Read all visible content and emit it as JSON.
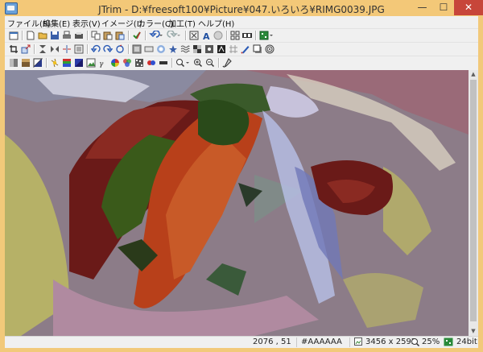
{
  "window": {
    "title": "JTrim - D:¥freesoft100¥Picture¥047.いろいろ¥RIMG0039.JPG"
  },
  "window_controls": {
    "minimize": "—",
    "maximize": "☐",
    "close": "✕"
  },
  "menu": [
    "ファイル(F)",
    "編集(E)",
    "表示(V)",
    "イメージ(I)",
    "カラー(C)",
    "加工(T)",
    "ヘルプ(H)"
  ],
  "toolbars": {
    "row1": [
      "new-window",
      "new",
      "open",
      "save",
      "print",
      "copy",
      "paste",
      "paste-new",
      "apply",
      "undo",
      "redo",
      "fit-window",
      "text",
      "stamp",
      "grid-view",
      "film-strip",
      "color-depth"
    ],
    "row2": [
      "crop",
      "resize",
      "flip-vertical",
      "flip-horizontal",
      "mirror",
      "margin",
      "rotate-left",
      "rotate-right",
      "rotate-free",
      "emboss",
      "border",
      "blur",
      "sharpen",
      "mosaic",
      "wave",
      "spot",
      "edge",
      "unknown",
      "pen",
      "shadow",
      "spiral"
    ],
    "row3": [
      "grayscale",
      "sepia",
      "negative",
      "brightness",
      "gamma",
      "hue",
      "image-adjust",
      "contrast",
      "rgb-balance",
      "color-balance",
      "noise",
      "color-replace",
      "posterize",
      "zoom",
      "zoom-in",
      "zoom-out",
      "eyedropper"
    ]
  },
  "status": {
    "coords": "2076 , 51",
    "color_hex": "#AAAAAA",
    "dimensions": "3456 x 2592",
    "zoom": "25%",
    "bit_depth": "24bit"
  },
  "colors": {
    "title_bar": "#f3c878",
    "close_button": "#c7463a",
    "frame": "#f0f0f0"
  }
}
